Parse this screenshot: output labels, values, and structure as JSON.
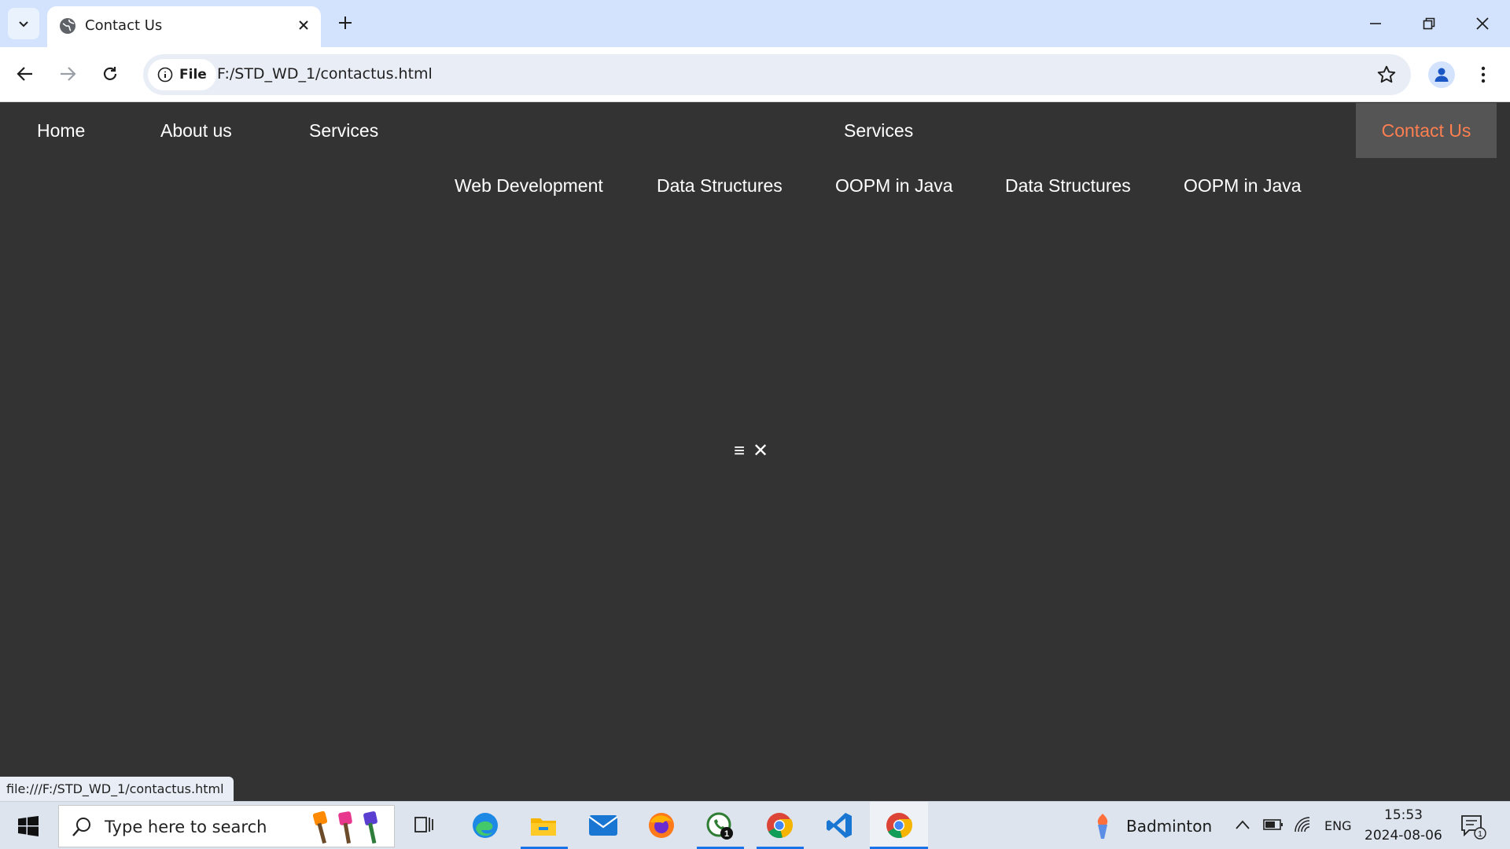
{
  "browser": {
    "tab_title": "Contact Us",
    "chip_label": "File",
    "url": "F:/STD_WD_1/contactus.html",
    "status_url": "file:///F:/STD_WD_1/contactus.html"
  },
  "nav": {
    "home": "Home",
    "about": "About us",
    "services": "Services",
    "services_dropdown": "Services",
    "contact": "Contact Us",
    "sub": [
      "Web Development",
      "Data Structures",
      "OOPM in Java",
      "Data Structures",
      "OOPM in Java"
    ],
    "menu_icon": "≡",
    "close_icon": "✕"
  },
  "taskbar": {
    "search_placeholder": "Type here to search",
    "weather_label": "Badminton",
    "language": "ENG",
    "time": "15:53",
    "date": "2024-08-06",
    "whatsapp_badge": "1",
    "notification_badge": "1"
  },
  "colors": {
    "page_bg": "#333333",
    "active_bg": "#555555",
    "active_text": "#ff7f50",
    "tabbar_bg": "#d3e3fd"
  }
}
